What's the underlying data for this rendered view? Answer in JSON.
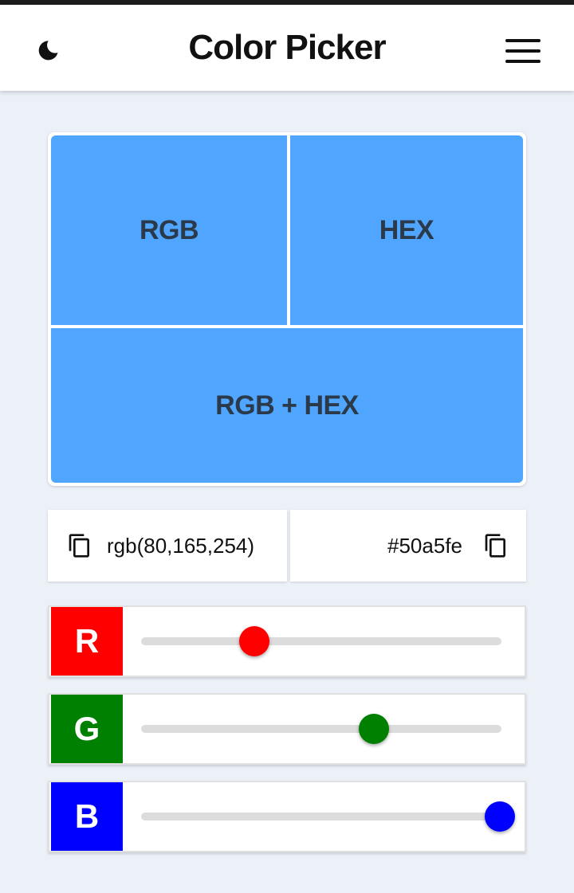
{
  "header": {
    "title": "Color Picker",
    "left_icon": "moon-icon",
    "right_icon": "menu-icon"
  },
  "preview": {
    "color": "#50a5fe",
    "cells": {
      "rgb": "RGB",
      "hex": "HEX",
      "both": "RGB + HEX"
    }
  },
  "values": {
    "rgb": "rgb(80,165,254)",
    "hex": "#50a5fe",
    "copy_icon": "copy-icon"
  },
  "sliders": {
    "r": {
      "label": "R",
      "value": 80,
      "max": 255,
      "color": "#ff0000"
    },
    "g": {
      "label": "G",
      "value": 165,
      "max": 255,
      "color": "#008000"
    },
    "b": {
      "label": "B",
      "value": 254,
      "max": 255,
      "color": "#0000ff"
    }
  },
  "colors": {
    "page_bg": "#ecf1f8",
    "text": "#111111",
    "cell_text": "#2b3a4a",
    "track": "#dcdcdc"
  }
}
